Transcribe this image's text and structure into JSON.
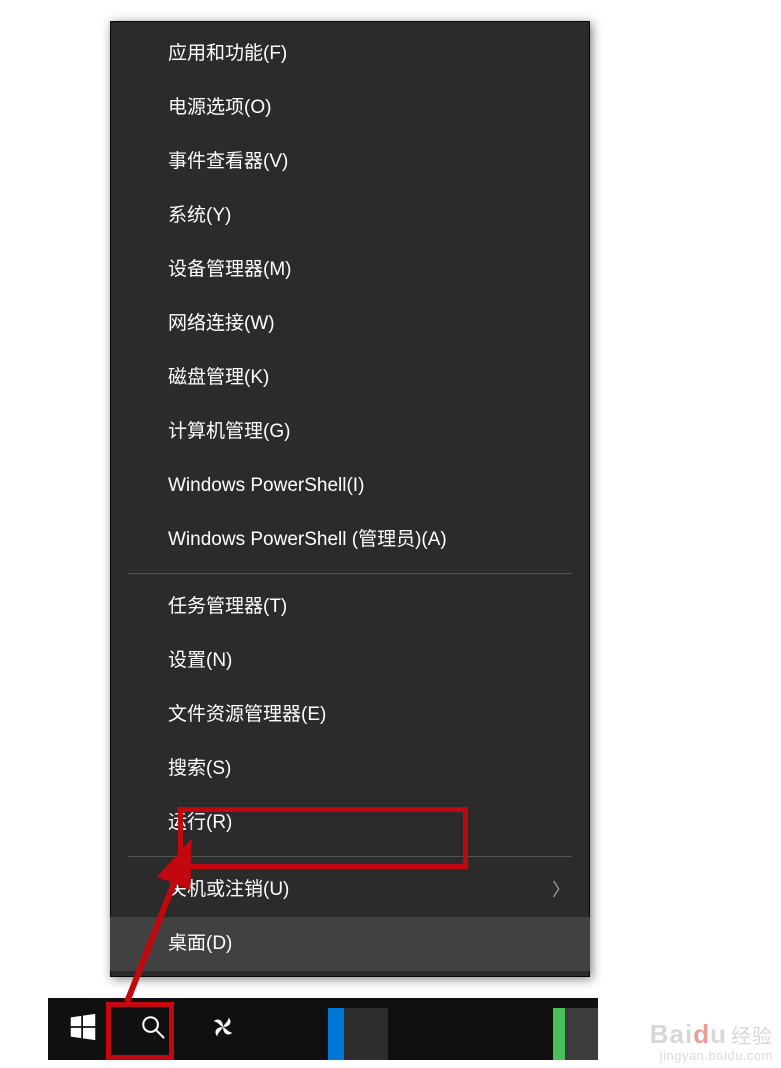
{
  "menu": {
    "groups": [
      {
        "items": [
          {
            "key": "apps-features",
            "label": "应用和功能(F)"
          },
          {
            "key": "power-options",
            "label": "电源选项(O)"
          },
          {
            "key": "event-viewer",
            "label": "事件查看器(V)"
          },
          {
            "key": "system",
            "label": "系统(Y)"
          },
          {
            "key": "device-manager",
            "label": "设备管理器(M)"
          },
          {
            "key": "network-connections",
            "label": "网络连接(W)"
          },
          {
            "key": "disk-management",
            "label": "磁盘管理(K)"
          },
          {
            "key": "computer-management",
            "label": "计算机管理(G)"
          },
          {
            "key": "powershell",
            "label": "Windows PowerShell(I)"
          },
          {
            "key": "powershell-admin",
            "label": "Windows PowerShell (管理员)(A)"
          }
        ]
      },
      {
        "items": [
          {
            "key": "task-manager",
            "label": "任务管理器(T)"
          },
          {
            "key": "settings",
            "label": "设置(N)"
          },
          {
            "key": "file-explorer",
            "label": "文件资源管理器(E)"
          },
          {
            "key": "search",
            "label": "搜索(S)"
          },
          {
            "key": "run",
            "label": "运行(R)",
            "highlighted": true
          }
        ]
      },
      {
        "items": [
          {
            "key": "shutdown-signout",
            "label": "关机或注销(U)",
            "submenu": true
          },
          {
            "key": "desktop",
            "label": "桌面(D)",
            "hover": true
          }
        ]
      }
    ]
  },
  "watermark": {
    "brand_part1": "Bai",
    "brand_part2": "d",
    "brand_part3": "u",
    "brand_cn": "经验",
    "url": "jingyan.baidu.com"
  },
  "annotations": {
    "arrow_color": "#c3070e",
    "highlight_color": "#c3070e"
  }
}
